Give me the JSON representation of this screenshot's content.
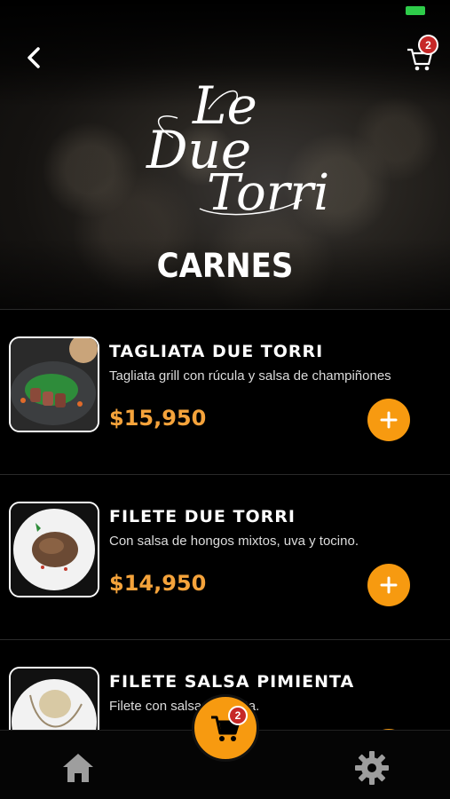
{
  "header": {
    "cart_count": "2",
    "logo_line1": "Le",
    "logo_line2": "Due",
    "logo_line3": "Torri"
  },
  "category": {
    "title": "CARNES"
  },
  "items": [
    {
      "name": "TAGLIATA DUE TORRI",
      "description": "Tagliata grill con rúcula y salsa de champiñones",
      "price": "$15,950"
    },
    {
      "name": "FILETE DUE TORRI",
      "description": "Con salsa de hongos mixtos, uva y tocino.",
      "price": "$14,950"
    },
    {
      "name": "FILETE SALSA PIMIENTA",
      "description": "Filete con salsa pimienta.",
      "price": ""
    }
  ],
  "bottom_nav": {
    "cart_count": "2",
    "home_icon": "home-icon",
    "settings_icon": "gear-icon",
    "cart_icon": "cart-icon"
  },
  "colors": {
    "accent": "#f79a10",
    "price": "#f5a33b",
    "badge": "#c62828",
    "background": "#000000"
  }
}
